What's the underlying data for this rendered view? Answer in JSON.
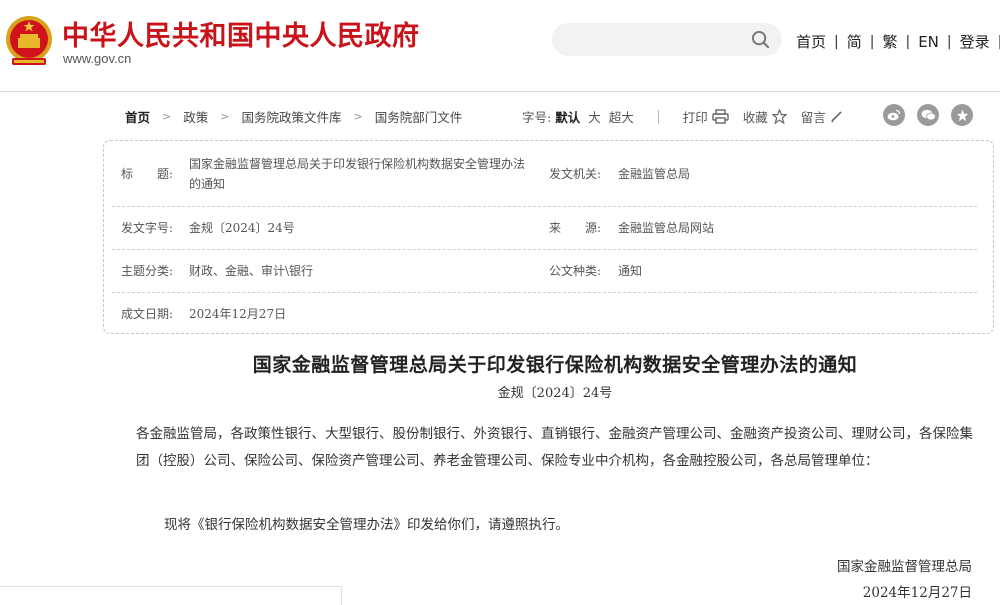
{
  "header": {
    "site_title": "中华人民共和国中央人民政府",
    "site_url": "www.gov.cn",
    "search": {
      "placeholder": ""
    },
    "nav": [
      "首页",
      "简",
      "繁",
      "EN",
      "登录"
    ],
    "title_color": "#c8131a"
  },
  "breadcrumb": [
    "首页",
    "政策",
    "国务院政策文件库",
    "国务院部门文件"
  ],
  "tools": {
    "font_size_label": "字号:",
    "font_sizes": [
      "默认",
      "大",
      "超大"
    ],
    "print": "打印",
    "favorite": "收藏",
    "comment": "留言"
  },
  "share_icons": [
    "weibo-icon",
    "wechat-icon",
    "star-share-icon"
  ],
  "info": {
    "title_label": "标　　题:",
    "title_value_line1": "国家金融监督管理总局关于印发银行保险机构数据安全管理办法",
    "title_value_line2": "的通知",
    "issuer_label": "发文机关:",
    "issuer_value": "金融监管总局",
    "doc_no_label": "发文字号:",
    "doc_no_value": "金规〔2024〕24号",
    "source_label": "来　　源:",
    "source_value": "金融监管总局网站",
    "topic_label": "主题分类:",
    "topic_value": "财政、金融、审计\\银行",
    "type_label": "公文种类:",
    "type_value": "通知",
    "date_label": "成文日期:",
    "date_value": "2024年12月27日"
  },
  "document": {
    "title": "国家金融监督管理总局关于印发银行保险机构数据安全管理办法的通知",
    "number": "金规〔2024〕24号",
    "recipients": "各金融监管局，各政策性银行、大型银行、股份制银行、外资银行、直销银行、金融资产管理公司、金融资产投资公司、理财公司，各保险集团（控股）公司、保险公司、保险资产管理公司、养老金管理公司、保险专业中介机构，各金融控股公司，各总局管理单位：",
    "body": "现将《银行保险机构数据安全管理办法》印发给你们，请遵照执行。",
    "signer": "国家金融监督管理总局",
    "date": "2024年12月27日"
  }
}
